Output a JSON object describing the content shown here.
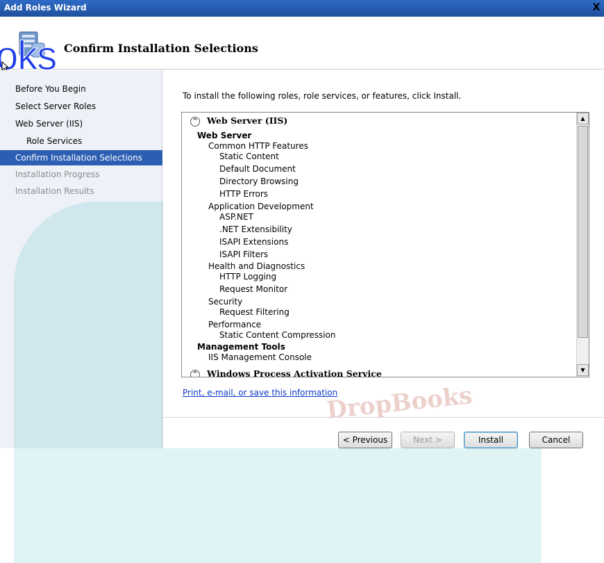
{
  "window": {
    "title": "Add Roles Wizard",
    "close_glyph": "X"
  },
  "header": {
    "title": "Confirm Installation Selections"
  },
  "overlay": {
    "text": "oks"
  },
  "nav": {
    "items": [
      {
        "label": "Before You Begin",
        "state": "normal"
      },
      {
        "label": "Select Server Roles",
        "state": "normal"
      },
      {
        "label": "Web Server (IIS)",
        "state": "normal"
      },
      {
        "label": "Role Services",
        "state": "normal",
        "sub": true
      },
      {
        "label": "Confirm Installation Selections",
        "state": "selected"
      },
      {
        "label": "Installation Progress",
        "state": "disabled"
      },
      {
        "label": "Installation Results",
        "state": "disabled"
      }
    ]
  },
  "content": {
    "intro": "To install the following roles, role services, or features, click Install.",
    "groups": [
      {
        "title": "Web Server (IIS)",
        "toggle": "^"
      },
      {
        "title": "Windows Process Activation Service",
        "toggle": "^"
      }
    ],
    "lines": [
      {
        "text": "Web Server",
        "level": 0,
        "bold": true
      },
      {
        "text": "Common HTTP Features",
        "level": 1
      },
      {
        "text": "Static Content",
        "level": 2
      },
      {
        "text": "Default Document",
        "level": 2
      },
      {
        "text": "Directory Browsing",
        "level": 2
      },
      {
        "text": "HTTP Errors",
        "level": 2
      },
      {
        "text": "Application Development",
        "level": 1
      },
      {
        "text": "ASP.NET",
        "level": 2
      },
      {
        "text": ".NET Extensibility",
        "level": 2
      },
      {
        "text": "ISAPI Extensions",
        "level": 2
      },
      {
        "text": "ISAPI Filters",
        "level": 2
      },
      {
        "text": "Health and Diagnostics",
        "level": 1
      },
      {
        "text": "HTTP Logging",
        "level": 2
      },
      {
        "text": "Request Monitor",
        "level": 2
      },
      {
        "text": "Security",
        "level": 1
      },
      {
        "text": "Request Filtering",
        "level": 2
      },
      {
        "text": "Performance",
        "level": 1
      },
      {
        "text": "Static Content Compression",
        "level": 2
      },
      {
        "text": "Management Tools",
        "level": 0,
        "bold": true
      },
      {
        "text": "IIS Management Console",
        "level": 1
      }
    ],
    "link": "Print, e-mail, or save this information"
  },
  "buttons": {
    "previous": "< Previous",
    "next": "Next >",
    "install": "Install",
    "cancel": "Cancel"
  },
  "watermark": {
    "text": "DropBooks"
  },
  "colors": {
    "titlebar": "#2e6bc6",
    "selected": "#2c5fb3",
    "link": "#0b37c9",
    "nav_bg": "#eef2f8"
  }
}
